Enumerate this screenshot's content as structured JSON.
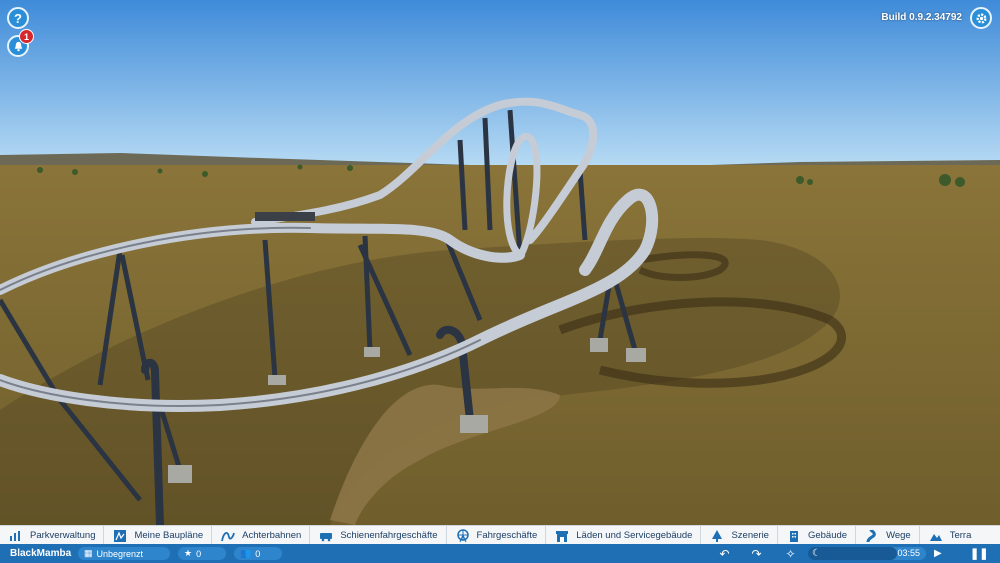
{
  "hud": {
    "help_glyph": "?",
    "notification_count": "1",
    "build": "Build 0.9.2.34792"
  },
  "menu": {
    "items": [
      {
        "label": "Parkverwaltung",
        "icon": "park-management-icon"
      },
      {
        "label": "Meine Baupläne",
        "icon": "blueprints-icon"
      },
      {
        "label": "Achterbahnen",
        "icon": "rollercoaster-icon"
      },
      {
        "label": "Schienenfahrgeschäfte",
        "icon": "track-ride-icon"
      },
      {
        "label": "Fahrgeschäfte",
        "icon": "ferris-wheel-icon"
      },
      {
        "label": "Läden und Servicegebäude",
        "icon": "shop-icon"
      },
      {
        "label": "Szenerie",
        "icon": "tree-icon"
      },
      {
        "label": "Gebäude",
        "icon": "building-icon"
      },
      {
        "label": "Wege",
        "icon": "path-icon"
      },
      {
        "label": "Terra",
        "icon": "terrain-icon"
      }
    ]
  },
  "status": {
    "park_name": "BlackMamba",
    "money": "Unbegrenzt",
    "rating": "0",
    "guests": "0",
    "time": "03:55",
    "day_progress": 0.75
  },
  "colors": {
    "menu_text": "#1d3f66",
    "menu_icon": "#1f6fb4",
    "status_bar": "#1f6fb4",
    "badge": "#d7262c"
  }
}
